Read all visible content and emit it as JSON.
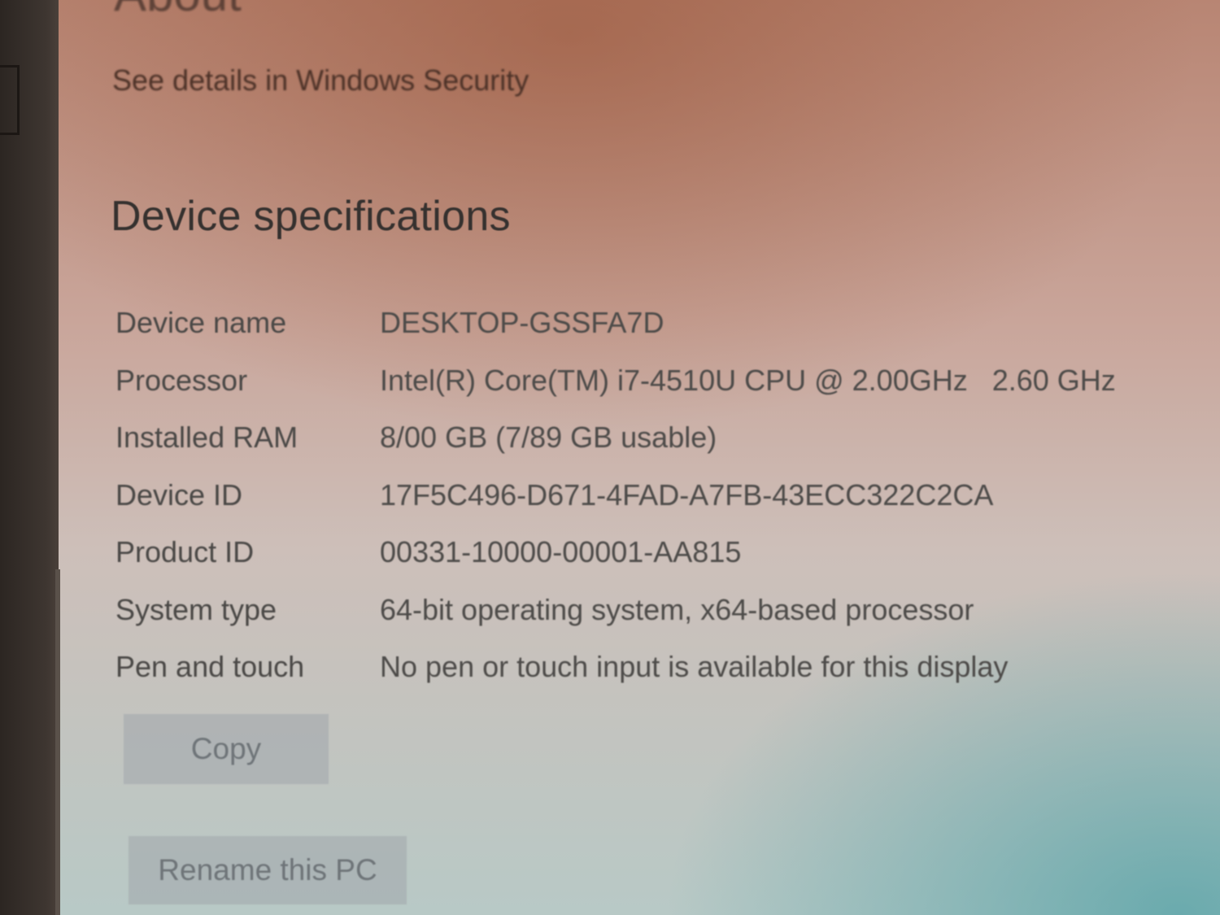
{
  "header": {
    "title": "About",
    "security_link": "See details in Windows Security"
  },
  "device_specifications": {
    "title": "Device specifications",
    "rows": [
      {
        "label": "Device name",
        "value": "DESKTOP-GSSFA7D"
      },
      {
        "label": "Processor",
        "value": "Intel(R) Core(TM) i7-4510U CPU @ 2.00GHz   2.60 GHz"
      },
      {
        "label": "Installed RAM",
        "value": "8/00 GB (7/89 GB usable)"
      },
      {
        "label": "Device ID",
        "value": "17F5C496-D671-4FAD-A7FB-43ECC322C2CA"
      },
      {
        "label": "Product ID",
        "value": "00331-10000-00001-AA815"
      },
      {
        "label": "System type",
        "value": "64-bit operating system, x64-based processor"
      },
      {
        "label": "Pen and touch",
        "value": "No pen or touch input is available for this display"
      }
    ],
    "copy_label": "Copy"
  },
  "rename_label": "Rename this PC"
}
